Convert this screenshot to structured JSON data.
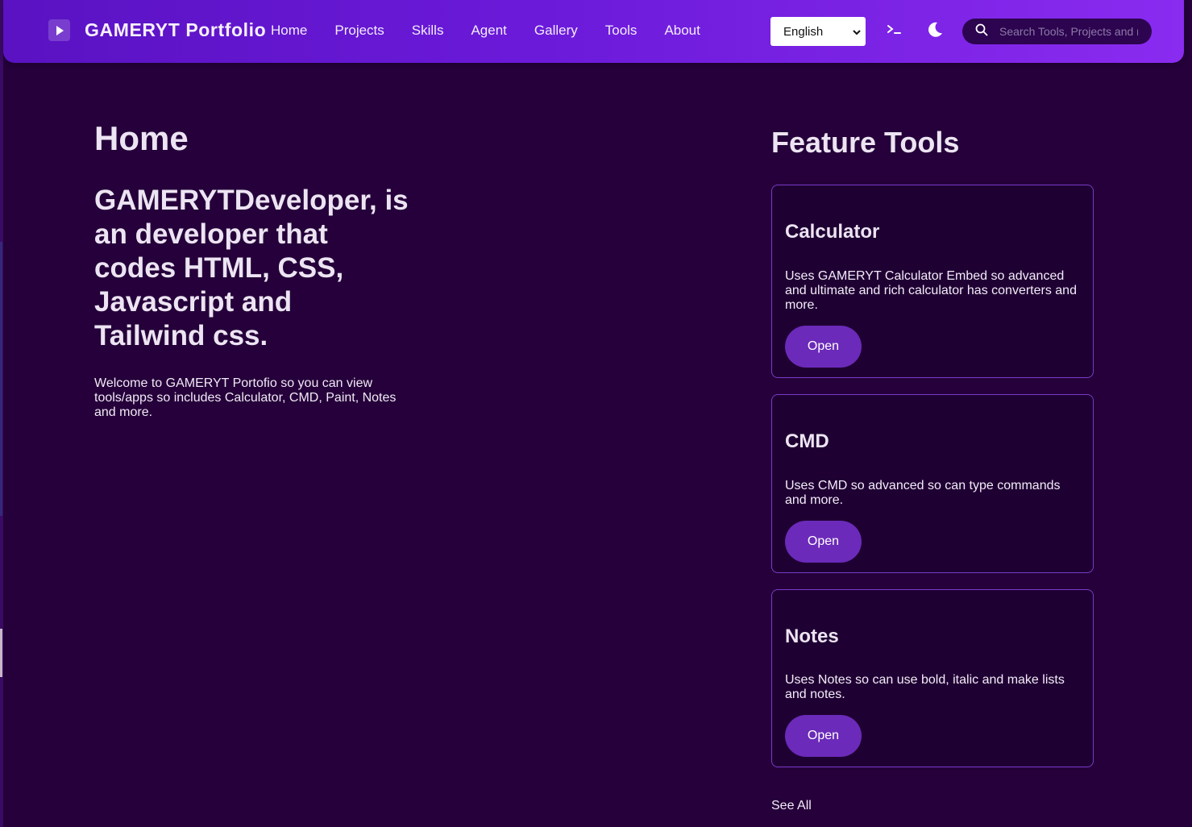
{
  "brand": {
    "title": "GAMERYT Portfolio",
    "logo_icon": "play-icon"
  },
  "nav": {
    "links": [
      {
        "label": "Home"
      },
      {
        "label": "Projects"
      },
      {
        "label": "Skills"
      },
      {
        "label": "Agent"
      },
      {
        "label": "Gallery"
      },
      {
        "label": "Tools"
      },
      {
        "label": "About"
      }
    ],
    "language": "English",
    "terminal_icon": "terminal-icon",
    "theme_icon": "moon-icon",
    "search_placeholder": "Search Tools, Projects and m"
  },
  "home": {
    "title": "Home",
    "headline": "GAMERYTDeveloper, is an developer that codes HTML, CSS, Javascript and Tailwind css.",
    "description": "Welcome to GAMERYT Portofio so you can view tools/apps so includes Calculator, CMD, Paint, Notes and more."
  },
  "features": {
    "title": "Feature Tools",
    "cards": [
      {
        "title": "Calculator",
        "description": "Uses GAMERYT Calculator Embed so advanced and ultimate and rich calculator has converters and more.",
        "button": "Open"
      },
      {
        "title": "CMD",
        "description": "Uses CMD so advanced so can type commands and more.",
        "button": "Open"
      },
      {
        "title": "Notes",
        "description": "Uses Notes so can use bold, italic and make lists and notes.",
        "button": "Open"
      }
    ],
    "see_all": "See All"
  },
  "colors": {
    "background": "#25003a",
    "navbar_start": "#5a12c2",
    "navbar_end": "#8a2bf0",
    "card_border": "#7a3bc8",
    "button": "#6b2ab9"
  }
}
